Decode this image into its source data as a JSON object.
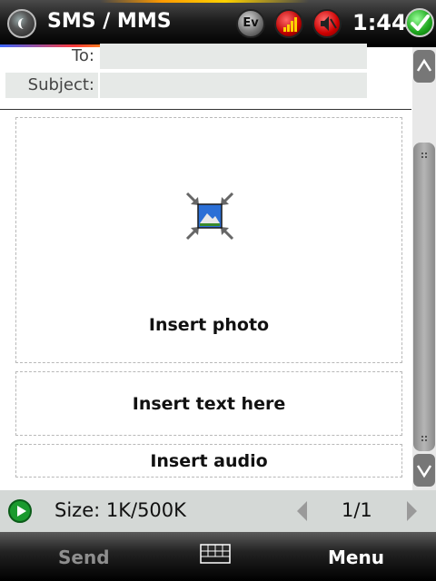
{
  "title_bar": {
    "app_title": "SMS / MMS",
    "time": "1:44",
    "ev_label": "Ev",
    "icons": [
      "start-icon",
      "ev-status-icon",
      "signal-icon",
      "sound-off-icon",
      "ok-check-icon"
    ]
  },
  "header": {
    "to_label": "To:",
    "to_value": "",
    "subject_label": "Subject:",
    "subject_value": ""
  },
  "slides": {
    "photo_label": "Insert photo",
    "text_label": "Insert text here",
    "audio_label": "Insert audio"
  },
  "status_bar": {
    "size_text": "Size: 1K/500K",
    "page_text": "1/1"
  },
  "soft_keys": {
    "left": "Send",
    "right": "Menu"
  },
  "colors": {
    "play": "#1b9a2e",
    "ok": "#2a2",
    "field_bg": "#e6e9e7"
  }
}
